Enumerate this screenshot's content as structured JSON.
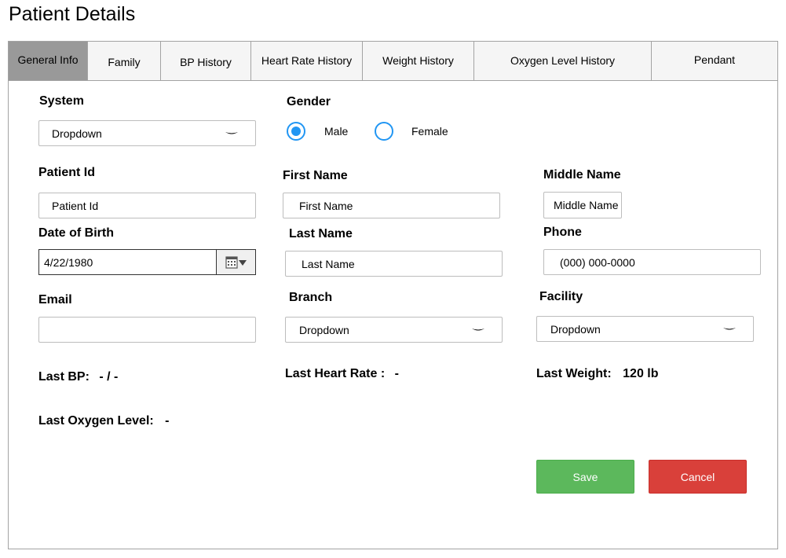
{
  "page": {
    "title": "Patient Details"
  },
  "tabs": [
    {
      "label": "General Info"
    },
    {
      "label": "Family"
    },
    {
      "label": "BP History"
    },
    {
      "label": "Heart Rate History"
    },
    {
      "label": "Weight History"
    },
    {
      "label": "Oxygen Level History"
    },
    {
      "label": "Pendant"
    }
  ],
  "form": {
    "system": {
      "label": "System",
      "value": "Dropdown"
    },
    "gender": {
      "label": "Gender",
      "options": [
        "Male",
        "Female"
      ],
      "selected": "Male"
    },
    "patient_id": {
      "label": "Patient Id",
      "placeholder": "Patient Id"
    },
    "first_name": {
      "label": "First Name",
      "placeholder": "First Name"
    },
    "middle_name": {
      "label": "Middle Name",
      "placeholder": "Middle Name"
    },
    "dob": {
      "label": "Date of Birth",
      "value": "4/22/1980"
    },
    "last_name": {
      "label": "Last Name",
      "placeholder": "Last Name"
    },
    "phone": {
      "label": "Phone",
      "placeholder": "(000) 000-0000"
    },
    "email": {
      "label": "Email",
      "value": ""
    },
    "branch": {
      "label": "Branch",
      "value": "Dropdown"
    },
    "facility": {
      "label": "Facility",
      "value": "Dropdown"
    }
  },
  "stats": {
    "last_bp": {
      "label": "Last BP:",
      "value": "- / -"
    },
    "last_heart_rate": {
      "label": "Last Heart Rate :",
      "value": "-"
    },
    "last_weight": {
      "label": "Last Weight:",
      "value": "120 lb"
    },
    "last_oxygen": {
      "label": "Last Oxygen Level:",
      "value": "-"
    }
  },
  "actions": {
    "save_label": "Save",
    "cancel_label": "Cancel"
  },
  "colors": {
    "accent": "#2196f3",
    "save": "#5cb85c",
    "cancel": "#d9403a",
    "active_tab": "#999999"
  },
  "icons": {
    "calendar": "calendar-icon",
    "dropdown": "chevron-down-icon"
  }
}
